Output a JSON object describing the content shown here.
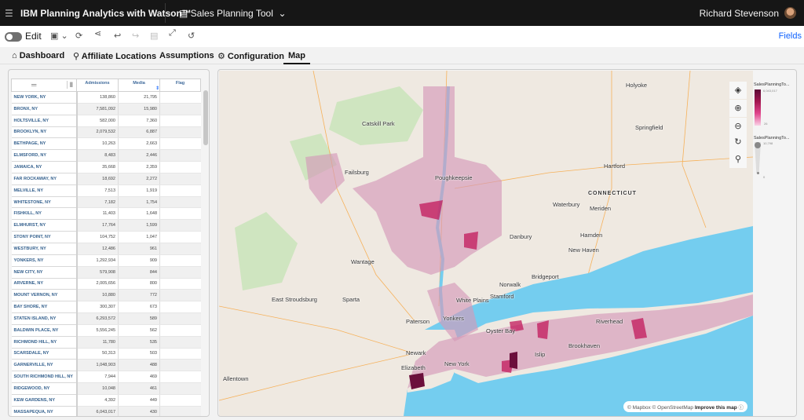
{
  "header": {
    "menu_icon": "hamburger-icon",
    "title": "IBM Planning Analytics with Watson™",
    "app_icon": "document-icon",
    "app_name": "Sales Planning Tool",
    "user": "Richard Stevenson"
  },
  "toolbar": {
    "edit_label": "Edit",
    "fields_label": "Fields",
    "icons": [
      "save-icon",
      "refresh-icon",
      "share-icon",
      "undo-icon",
      "redo-icon",
      "snapshot-icon",
      "fullscreen-icon",
      "reset-icon"
    ]
  },
  "tabs": [
    {
      "label": "Dashboard",
      "icon": "home-icon"
    },
    {
      "label": "Affiliate Locations",
      "icon": "location-icon"
    },
    {
      "label": "Assumptions"
    },
    {
      "label": "Configuration",
      "icon": "gear-icon"
    },
    {
      "label": "Map",
      "active": true
    }
  ],
  "table": {
    "columns": [
      "Admissions",
      "Media",
      "Flag"
    ],
    "rows": [
      [
        "NEW YORK, NY",
        "138,860",
        "21,795"
      ],
      [
        "BRONX, NY",
        "7,581,092",
        "15,980"
      ],
      [
        "HOLTSVILLE, NY",
        "582,000",
        "7,360"
      ],
      [
        "BROOKLYN, NY",
        "2,079,532",
        "6,887"
      ],
      [
        "BETHPAGE, NY",
        "10,263",
        "2,663"
      ],
      [
        "ELMSFORD, NY",
        "8,483",
        "2,446"
      ],
      [
        "JAMAICA, NY",
        "35,668",
        "2,359"
      ],
      [
        "FAR ROCKAWAY, NY",
        "18,692",
        "2,272"
      ],
      [
        "MELVILLE, NY",
        "7,513",
        "1,919"
      ],
      [
        "WHITESTONE, NY",
        "7,182",
        "1,754"
      ],
      [
        "FISHKILL, NY",
        "11,403",
        "1,648"
      ],
      [
        "ELMHURST, NY",
        "17,764",
        "1,599"
      ],
      [
        "STONY POINT, NY",
        "104,752",
        "1,047"
      ],
      [
        "WESTBURY, NY",
        "12,486",
        "961"
      ],
      [
        "YONKERS, NY",
        "1,292,934",
        "909"
      ],
      [
        "NEW CITY, NY",
        "579,908",
        "844"
      ],
      [
        "ARVERNE, NY",
        "2,005,656",
        "800"
      ],
      [
        "MOUNT VERNON, NY",
        "10,880",
        "772"
      ],
      [
        "BAY SHORE, NY",
        "300,307",
        "673"
      ],
      [
        "STATEN ISLAND, NY",
        "6,293,572",
        "589"
      ],
      [
        "BALDWIN PLACE, NY",
        "5,556,245",
        "562"
      ],
      [
        "RICHMOND HILL, NY",
        "11,780",
        "535"
      ],
      [
        "SCARSDALE, NY",
        "50,313",
        "503"
      ],
      [
        "GARNERVILLE, NY",
        "1,048,903",
        "488"
      ],
      [
        "SOUTH RICHMOND HILL, NY",
        "7,944",
        "469"
      ],
      [
        "RIDGEWOOD, NY",
        "10,048",
        "461"
      ],
      [
        "KEW GARDENS, NY",
        "4,392",
        "449"
      ],
      [
        "MASSAPEQUA, NY",
        "6,043,017",
        "430"
      ]
    ]
  },
  "map": {
    "labels": [
      "Holyoke",
      "Springfield",
      "Catskill Park",
      "Failsburg",
      "Poughkeepsie",
      "Hartford",
      "CONNECTICUT",
      "Waterbury",
      "Meriden",
      "Danbury",
      "Hamden",
      "New Haven",
      "Wantage",
      "Sparta",
      "East Stroudsburg",
      "Norwalk",
      "Bridgeport",
      "Stamford",
      "White Plains",
      "Paterson",
      "Yonkers",
      "Oyster Bay",
      "Riverhead",
      "Brookhaven",
      "Islip",
      "Newark",
      "New York",
      "Elizabeth",
      "Allentown"
    ],
    "controls": [
      "layers-icon",
      "zoom-in-icon",
      "zoom-out-icon",
      "reset-rotation-icon",
      "search-icon"
    ],
    "attribution": {
      "mapbox": "© Mapbox",
      "osm": "© OpenStreetMap",
      "improve": "Improve this map"
    },
    "colors": {
      "land": "#efe9e1",
      "water": "#74cdef",
      "forest": "#cfe5c0",
      "choropleth_low": "#fad2e6",
      "choropleth_high": "#5c0a34"
    }
  },
  "legend": {
    "color_title": "SalesPlanningTo...",
    "color_max": "6,043,017",
    "color_min": "26",
    "size_title": "SalesPlanningTo...",
    "size_max": "10,798",
    "size_min": "0"
  }
}
